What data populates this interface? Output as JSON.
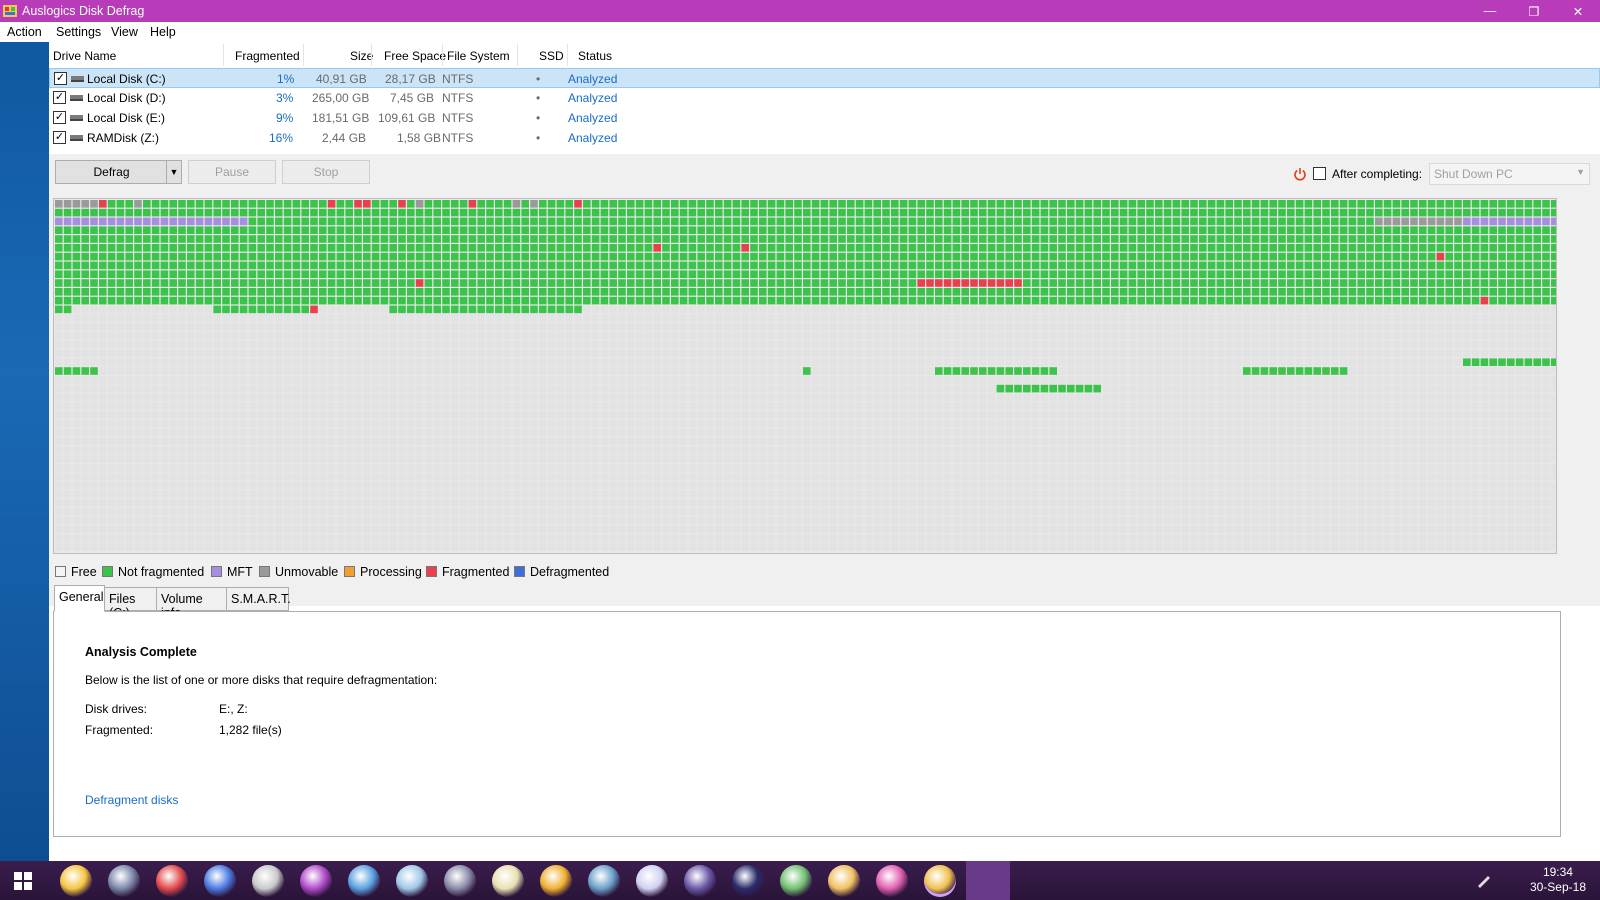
{
  "window": {
    "title": "Auslogics Disk Defrag",
    "controls": {
      "minimize": "—",
      "restore": "❐",
      "close": "✕"
    }
  },
  "menu": [
    "Action",
    "Settings",
    "View",
    "Help"
  ],
  "drive_table": {
    "headers": [
      "Drive Name",
      "Fragmented",
      "Size",
      "Free Space",
      "File System",
      "SSD",
      "Status"
    ],
    "rows": [
      {
        "name": "Local Disk (C:)",
        "fragmented": "1%",
        "size": "40,91 GB",
        "free": "28,17 GB",
        "fs": "NTFS",
        "ssd": "•",
        "status": "Analyzed",
        "checked": true,
        "selected": true
      },
      {
        "name": "Local Disk (D:)",
        "fragmented": "3%",
        "size": "265,00 GB",
        "free": "7,45 GB",
        "fs": "NTFS",
        "ssd": "•",
        "status": "Analyzed",
        "checked": true,
        "selected": false
      },
      {
        "name": "Local Disk (E:)",
        "fragmented": "9%",
        "size": "181,51 GB",
        "free": "109,61 GB",
        "fs": "NTFS",
        "ssd": "•",
        "status": "Analyzed",
        "checked": true,
        "selected": false
      },
      {
        "name": "RAMDisk (Z:)",
        "fragmented": "16%",
        "size": "2,44 GB",
        "free": "1,58 GB",
        "fs": "NTFS",
        "ssd": "•",
        "status": "Analyzed",
        "checked": true,
        "selected": false
      }
    ]
  },
  "controls": {
    "defrag_label": "Defrag",
    "pause_label": "Pause",
    "stop_label": "Stop",
    "after_completing_label": "After completing:",
    "after_completing_value": "Shut Down PC",
    "after_completing_checked": false
  },
  "cluster_map": {
    "colors": {
      "free": "#e3e3e3",
      "not_fragmented": "#3cc34b",
      "mft": "#a68ee0",
      "unmovable": "#9a9a9a",
      "processing": "#f0a030",
      "fragmented": "#e8404c",
      "defragmented": "#3f6fd6"
    },
    "rows": 40,
    "cols": 171
  },
  "legend": [
    {
      "label": "Free",
      "color": "#f4f4f4"
    },
    {
      "label": "Not fragmented",
      "color": "#3cc34b"
    },
    {
      "label": "MFT",
      "color": "#a68ee0"
    },
    {
      "label": "Unmovable",
      "color": "#9a9a9a"
    },
    {
      "label": "Processing",
      "color": "#f0a030"
    },
    {
      "label": "Fragmented",
      "color": "#e8404c"
    },
    {
      "label": "Defragmented",
      "color": "#3f6fd6"
    }
  ],
  "tabs": [
    "General",
    "Files (C:)",
    "Volume info",
    "S.M.A.R.T."
  ],
  "general": {
    "heading": "Analysis Complete",
    "description": "Below is the list of one or more disks that require defragmentation:",
    "disk_drives_label": "Disk drives:",
    "disk_drives_value": "E:, Z:",
    "fragmented_label": "Fragmented:",
    "fragmented_value": "1,282 file(s)",
    "link": "Defragment disks"
  },
  "taskbar": {
    "time": "19:34",
    "date": "30-Sep-18",
    "apps": [
      "app-1",
      "app-2",
      "app-3",
      "app-4",
      "app-5",
      "app-6",
      "app-7",
      "app-8",
      "app-9",
      "app-10",
      "app-11",
      "app-12",
      "app-13",
      "app-14",
      "app-15",
      "app-16",
      "app-17",
      "app-18",
      "app-19",
      "app-20"
    ]
  }
}
